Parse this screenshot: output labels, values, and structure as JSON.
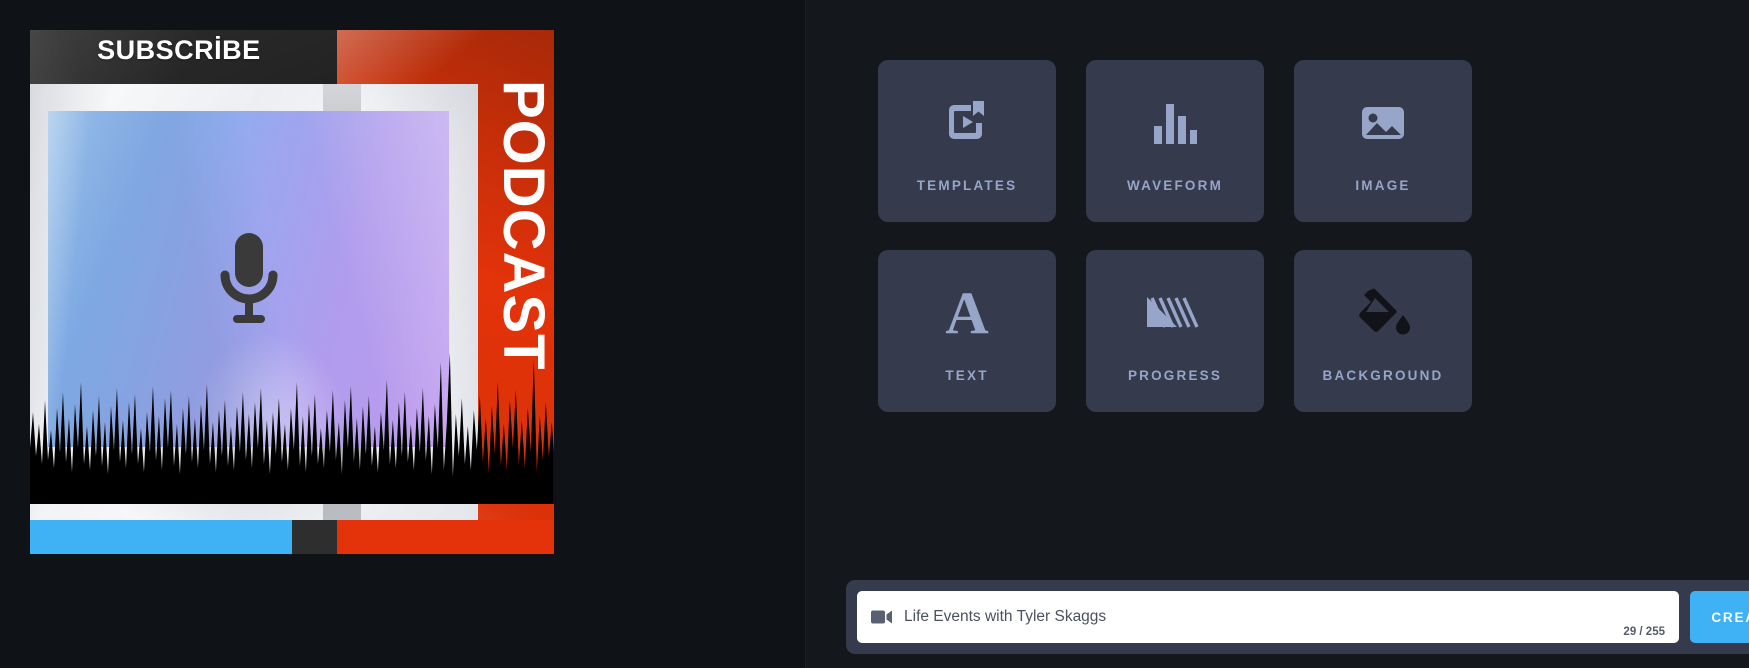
{
  "preview": {
    "artwork": {
      "subscribe_label": "SUBSCRİBE",
      "podcast_label": "PODCAST",
      "mic_icon": "microphone-icon",
      "colors": {
        "red": "#e4330a",
        "black": "#1c1c1c",
        "white": "#f2f3f5",
        "photo_blue": "#73c0f4",
        "photo_purple": "#bf9aee",
        "progress_fill": "#3fb2f5",
        "progress_track": "#2e2e2e"
      },
      "progress_percent": 50
    }
  },
  "editor": {
    "tools": [
      {
        "label": "TEMPLATES",
        "icon": "templates-icon"
      },
      {
        "label": "WAVEFORM",
        "icon": "waveform-icon"
      },
      {
        "label": "IMAGE",
        "icon": "image-icon"
      },
      {
        "label": "TEXT",
        "icon": "text-icon"
      },
      {
        "label": "PROGRESS",
        "icon": "progress-icon"
      },
      {
        "label": "BACKGROUND",
        "icon": "background-icon"
      }
    ],
    "bottom_bar": {
      "video_icon": "video-camera-icon",
      "title_value": "Life Events with Tyler Skaggs",
      "title_placeholder": "Life Events with Tyler Skaggs",
      "char_count": "29 / 255",
      "create_label": "CREATE",
      "create_color": "#3fb2f5"
    }
  },
  "theme": {
    "bg": "#14171c",
    "panel_bg": "#0f1216",
    "card_bg": "#353a4c",
    "label_color": "#96a5c8"
  }
}
